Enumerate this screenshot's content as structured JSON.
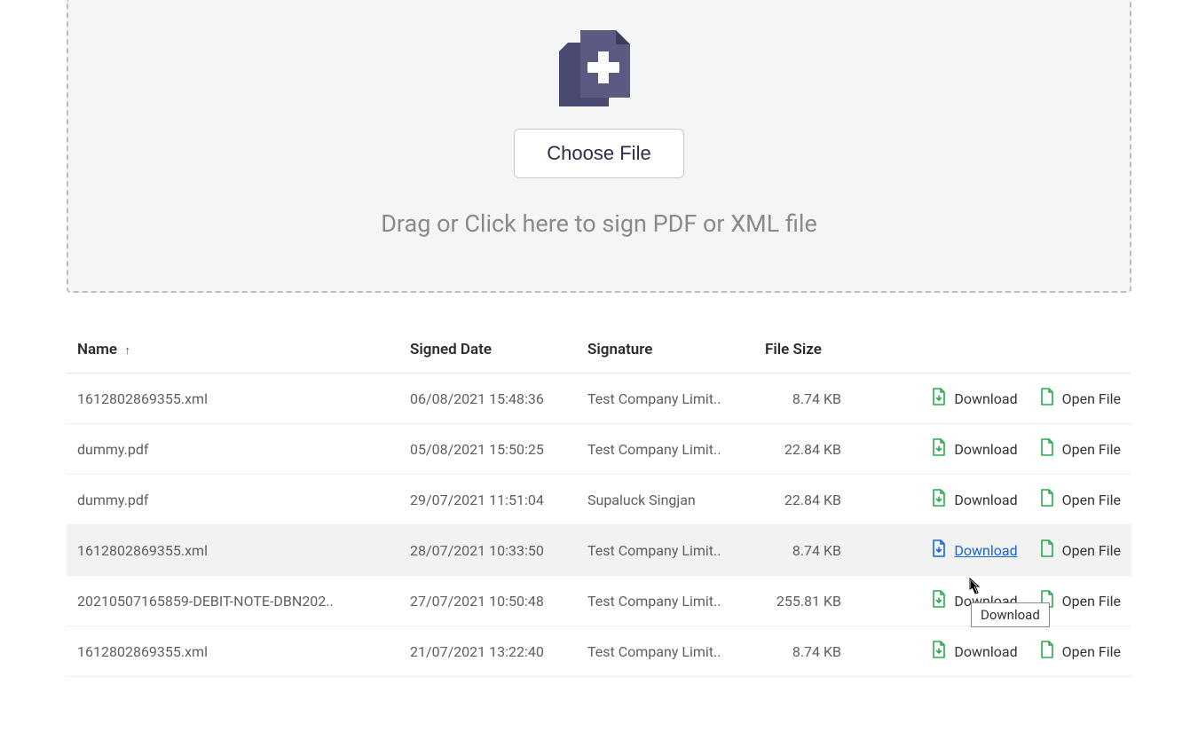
{
  "dropzone": {
    "choose_file_label": "Choose File",
    "drag_text": "Drag or Click here to sign PDF or XML file"
  },
  "table": {
    "headers": {
      "name": "Name",
      "sort_indicator": "↑",
      "signed_date": "Signed Date",
      "signature": "Signature",
      "file_size": "File Size"
    },
    "actions": {
      "download": "Download",
      "open_file": "Open File"
    },
    "rows": [
      {
        "name": "1612802869355.xml",
        "signed_date": "06/08/2021 15:48:36",
        "signature": "Test Company Limit..",
        "file_size": "8.74 KB",
        "hovered": false,
        "download_active": false
      },
      {
        "name": "dummy.pdf",
        "signed_date": "05/08/2021 15:50:25",
        "signature": "Test Company Limit..",
        "file_size": "22.84 KB",
        "hovered": false,
        "download_active": false
      },
      {
        "name": "dummy.pdf",
        "signed_date": "29/07/2021 11:51:04",
        "signature": "Supaluck Singjan",
        "file_size": "22.84 KB",
        "hovered": false,
        "download_active": false
      },
      {
        "name": "1612802869355.xml",
        "signed_date": "28/07/2021 10:33:50",
        "signature": "Test Company Limit..",
        "file_size": "8.74 KB",
        "hovered": true,
        "download_active": true
      },
      {
        "name": "20210507165859-DEBIT-NOTE-DBN202..",
        "signed_date": "27/07/2021 10:50:48",
        "signature": "Test Company Limit..",
        "file_size": "255.81 KB",
        "hovered": false,
        "download_active": false
      },
      {
        "name": "1612802869355.xml",
        "signed_date": "21/07/2021 13:22:40",
        "signature": "Test Company Limit..",
        "file_size": "8.74 KB",
        "hovered": false,
        "download_active": false
      }
    ]
  },
  "tooltip": {
    "text": "Download"
  },
  "colors": {
    "icon_green": "#2aa84f",
    "icon_blue": "#1565d6",
    "upload_icon": "#4a4a70"
  }
}
